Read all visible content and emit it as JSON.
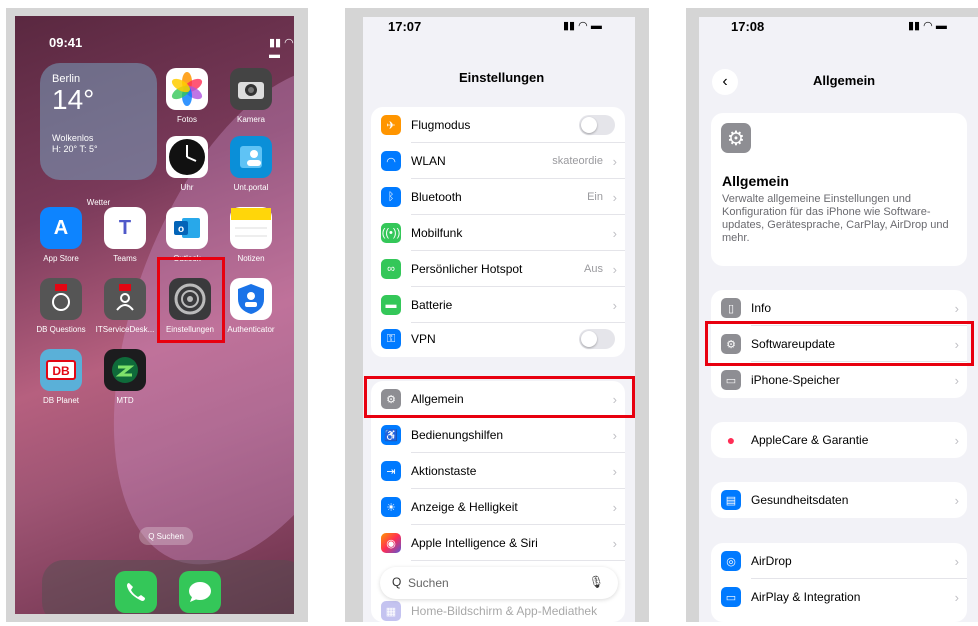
{
  "home": {
    "time": "09:41",
    "status_icons": "‧‧‧‧ ◖ ▬",
    "weather": {
      "city": "Berlin",
      "temp": "14°",
      "condition": "Wolkenlos",
      "hilo": "H: 20° T: 5°",
      "caption": "Wetter"
    },
    "apps": [
      {
        "label": "Fotos"
      },
      {
        "label": "Kamera"
      },
      {
        "label": "Uhr"
      },
      {
        "label": "Unt.portal"
      },
      {
        "label": "App Store"
      },
      {
        "label": "Teams"
      },
      {
        "label": "Outlook"
      },
      {
        "label": "Notizen"
      },
      {
        "label": "DB Questions"
      },
      {
        "label": "ITServiceDesk..."
      },
      {
        "label": "Einstellungen"
      },
      {
        "label": "Authenticator"
      },
      {
        "label": "DB Planet"
      },
      {
        "label": "MTD"
      }
    ],
    "search_label": "Q Suchen"
  },
  "settings": {
    "time": "17:07",
    "title": "Einstellungen",
    "rows_group1": [
      {
        "label": "Flugmodus",
        "value": "",
        "color": "#ff9500",
        "icon": "airplane-icon"
      },
      {
        "label": "WLAN",
        "value": "skateordie",
        "color": "#007aff",
        "icon": "wifi-icon"
      },
      {
        "label": "Bluetooth",
        "value": "Ein",
        "color": "#007aff",
        "icon": "bluetooth-icon"
      },
      {
        "label": "Mobilfunk",
        "value": "",
        "color": "#34c759",
        "icon": "antenna-icon"
      },
      {
        "label": "Persönlicher Hotspot",
        "value": "Aus",
        "color": "#34c759",
        "icon": "hotspot-icon"
      },
      {
        "label": "Batterie",
        "value": "",
        "color": "#34c759",
        "icon": "battery-icon"
      },
      {
        "label": "VPN",
        "value": "",
        "color": "#007aff",
        "icon": "vpn-icon"
      }
    ],
    "rows_group2": [
      {
        "label": "Allgemein",
        "color": "#8e8e93",
        "icon": "gear-icon"
      },
      {
        "label": "Bedienungshilfen",
        "color": "#007aff",
        "icon": "accessibility-icon"
      },
      {
        "label": "Aktionstaste",
        "color": "#007aff",
        "icon": "action-button-icon"
      },
      {
        "label": "Anzeige & Helligkeit",
        "color": "#007aff",
        "icon": "sun-icon"
      },
      {
        "label": "Apple Intelligence & Siri",
        "color": "#ff6b9a",
        "icon": "siri-icon"
      },
      {
        "label": "Home-Bildschirm & App-Mediathek",
        "color": "#5856d6",
        "icon": "home-screen-icon"
      }
    ],
    "search_placeholder": "Suchen"
  },
  "general": {
    "time": "17:08",
    "title": "Allgemein",
    "hero_title": "Allgemein",
    "hero_desc": "Verwalte allgemeine Einstellungen und Konfiguration für das iPhone wie Software-updates, Gerätesprache, CarPlay, AirDrop und mehr.",
    "rows_group1": [
      {
        "label": "Info",
        "color": "#8e8e93",
        "icon": "phone-info-icon"
      },
      {
        "label": "Softwareupdate",
        "color": "#8e8e93",
        "icon": "gear-icon"
      },
      {
        "label": "iPhone-Speicher",
        "color": "#8e8e93",
        "icon": "storage-icon"
      }
    ],
    "applecare_label": "AppleCare & Garantie",
    "health_label": "Gesundheitsdaten",
    "rows_group4": [
      {
        "label": "AirDrop",
        "color": "#007aff",
        "icon": "airdrop-icon"
      },
      {
        "label": "AirPlay & Integration",
        "color": "#007aff",
        "icon": "airplay-icon"
      }
    ]
  },
  "colors": {
    "highlight": "#e8000f",
    "ios_background": "#f2f2f7"
  }
}
